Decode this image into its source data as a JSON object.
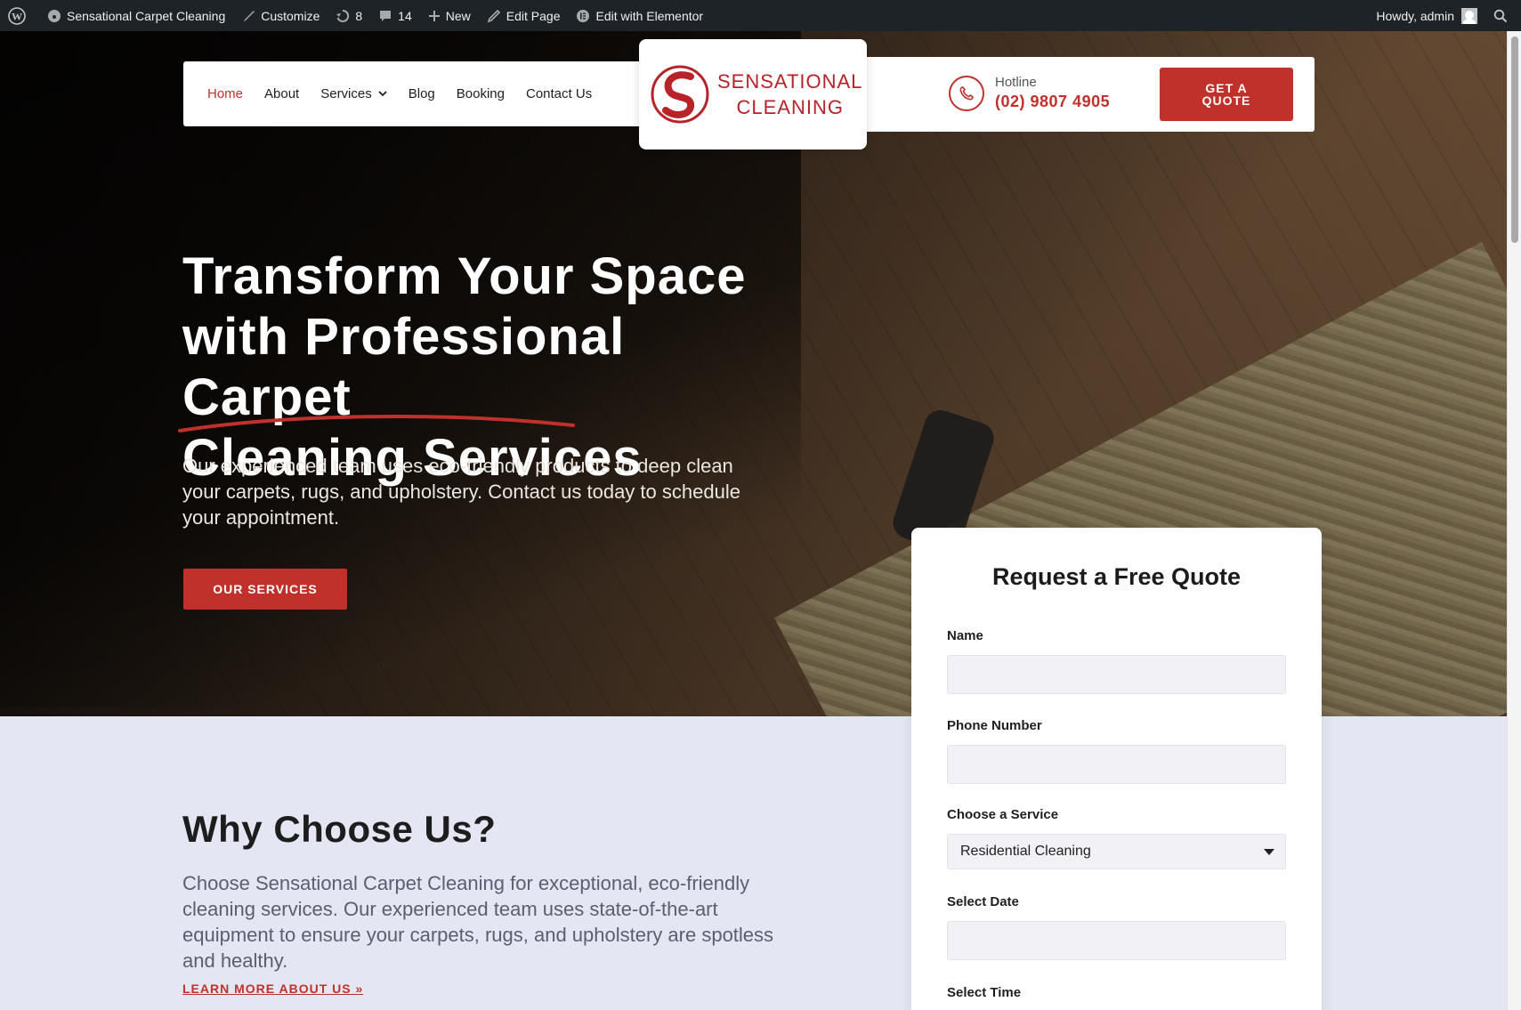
{
  "adminbar": {
    "site_name": "Sensational Carpet Cleaning",
    "customize": "Customize",
    "updates_count": "8",
    "comments_count": "14",
    "new": "New",
    "edit_page": "Edit Page",
    "edit_elementor": "Edit with Elementor",
    "howdy": "Howdy, admin"
  },
  "nav": {
    "items": [
      {
        "label": "Home",
        "active": true
      },
      {
        "label": "About"
      },
      {
        "label": "Services"
      },
      {
        "label": "Blog"
      },
      {
        "label": "Booking"
      },
      {
        "label": "Contact Us"
      }
    ]
  },
  "logo": {
    "line1": "SENSATIONAL",
    "line2": "CLEANING"
  },
  "hotline": {
    "label": "Hotline",
    "number": "(02) 9807 4905"
  },
  "quote_button": "GET A\nQUOTE",
  "hero": {
    "title_line1": "Transform Your Space",
    "title_line2": "with Professional Carpet",
    "title_line3": "Cleaning Services",
    "description": "Our experienced team uses eco-friendly products to deep clean your carpets, rugs, and upholstery. Contact us today to schedule your appointment.",
    "button": "OUR SERVICES"
  },
  "why": {
    "title": "Why Choose Us?",
    "description": "Choose Sensational Carpet Cleaning for exceptional, eco-friendly cleaning services. Our experienced team uses state-of-the-art equipment to ensure your carpets, rugs, and upholstery are spotless and healthy.",
    "link": "LEARN MORE ABOUT US »"
  },
  "form": {
    "title": "Request a Free Quote",
    "name_label": "Name",
    "phone_label": "Phone Number",
    "service_label": "Choose a Service",
    "service_value": "Residential Cleaning",
    "date_label": "Select Date",
    "time_label": "Select Time"
  },
  "colors": {
    "accent": "#c0312b",
    "admin_bar": "#1d2327",
    "section_bg": "#e4e6f3"
  }
}
